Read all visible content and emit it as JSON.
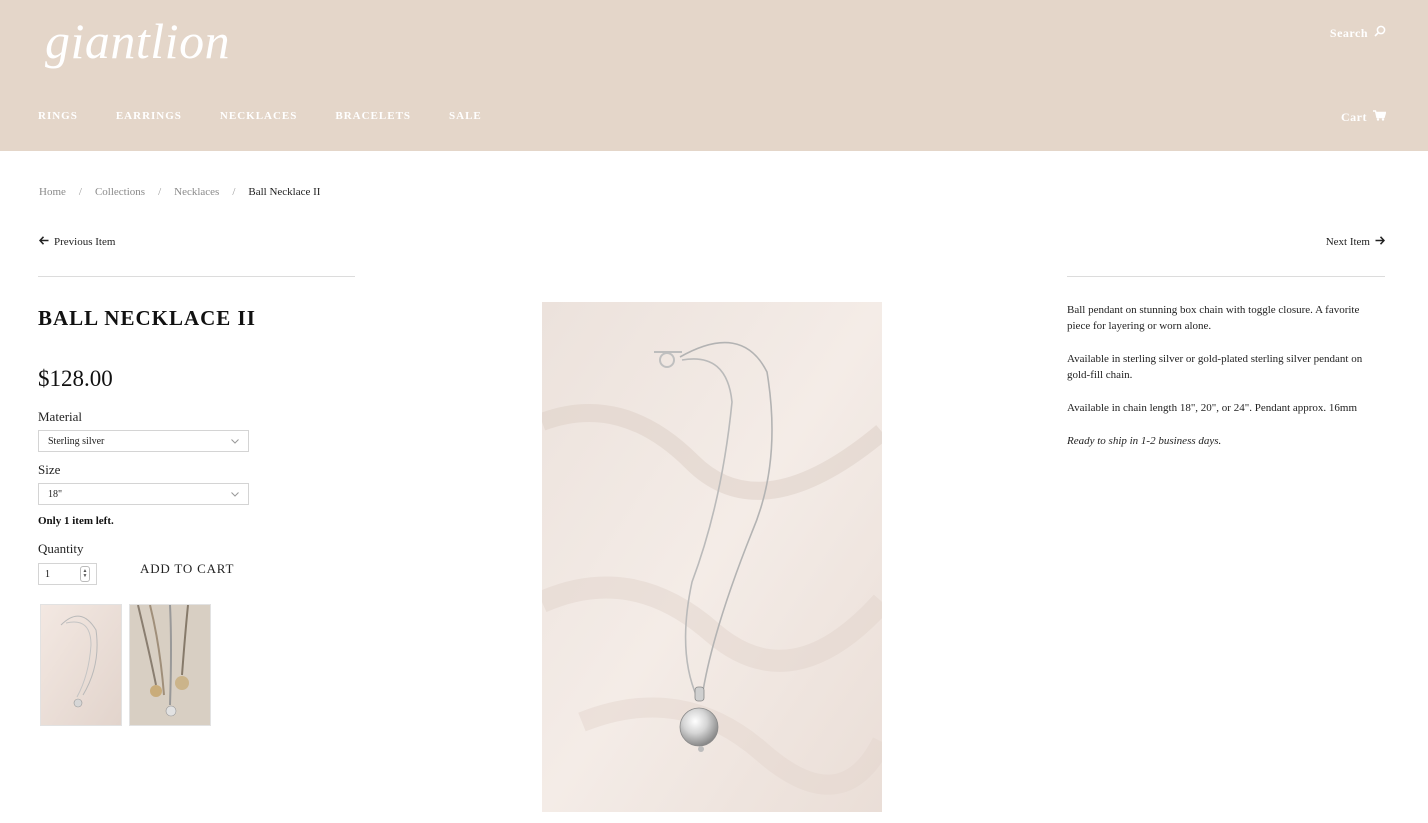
{
  "header": {
    "logo": "giantlion",
    "search_label": "Search",
    "search_icon": "search-icon",
    "cart_label": "Cart",
    "cart_icon": "cart-icon",
    "nav": [
      "RINGS",
      "EARRINGS",
      "NECKLACES",
      "BRACELETS",
      "SALE"
    ],
    "background": "#e4d6c9"
  },
  "breadcrumb": {
    "items": [
      "Home",
      "Collections",
      "Necklaces"
    ],
    "separator": "/",
    "current": "Ball Necklace II"
  },
  "pager": {
    "previous": "Previous Item",
    "next": "Next Item"
  },
  "product": {
    "title": "BALL NECKLACE II",
    "price": "$128.00",
    "material_label": "Material",
    "material_value": "Sterling silver",
    "size_label": "Size",
    "size_value": "18\"",
    "stock_text": "Only 1 item left.",
    "quantity_label": "Quantity",
    "quantity_value": "1",
    "add_to_cart": "ADD TO CART"
  },
  "description": [
    "Ball pendant on stunning box chain with toggle closure. A favorite piece for layering or worn alone.",
    "Available in sterling silver or gold-plated sterling silver pendant on gold-fill chain.",
    "Available in chain length 18\", 20\", or 24\". Pendant approx. 16mm"
  ],
  "shipping_note": "Ready to ship in 1-2 business days."
}
